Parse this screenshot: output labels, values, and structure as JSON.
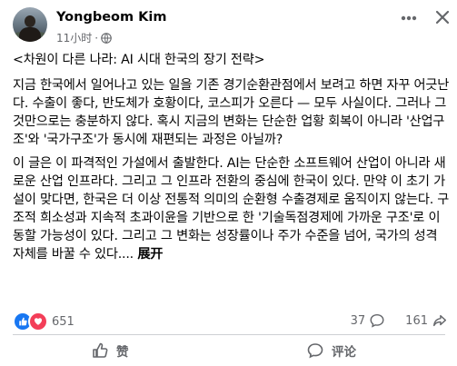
{
  "post": {
    "author": "Yongbeom Kim",
    "time": "11小时",
    "separator": "·",
    "title": "<차원이 다른 나라: AI 시대 한국의 장기 전략>",
    "paragraphs": [
      "지금 한국에서 일어나고 있는 일을 기존 경기순환관점에서 보려고 하면 자꾸 어긋난다. 수출이 좋다, 반도체가 호황이다, 코스피가 오른다 — 모두 사실이다. 그러나 그것만으로는 충분하지 않다. 혹시 지금의 변화는 단순한 업황 회복이 아니라 '산업구조'와 '국가구조'가 동시에 재편되는 과정은 아닐까?",
      "이 글은 이 파격적인 가설에서 출발한다. AI는 단순한 소프트웨어 산업이 아니라 새로운 산업 인프라다. 그리고 그 인프라 전환의 중심에 한국이 있다. 만약 이 초기 가설이 맞다면, 한국은 더 이상 전통적 의미의 순환형 수출경제로 움직이지 않는다. 구조적 희소성과 지속적 초과이윤을 기반으로 한 '기술독점경제에 가까운 구조'로 이동할 가능성이 있다. 그리고 그 변화는 성장률이나 주가 수준을 넘어, 국가의 성격 자체를 바꿀 수 있다...."
    ],
    "expand_label": "展开"
  },
  "engagement": {
    "reaction_count": "651",
    "comment_count": "37",
    "share_count": "161"
  },
  "actions": {
    "like_label": "赞",
    "comment_label": "评论"
  },
  "colors": {
    "like_blue": "#1877f2",
    "love_red": "#f33e58",
    "secondary_text": "#65676b"
  }
}
